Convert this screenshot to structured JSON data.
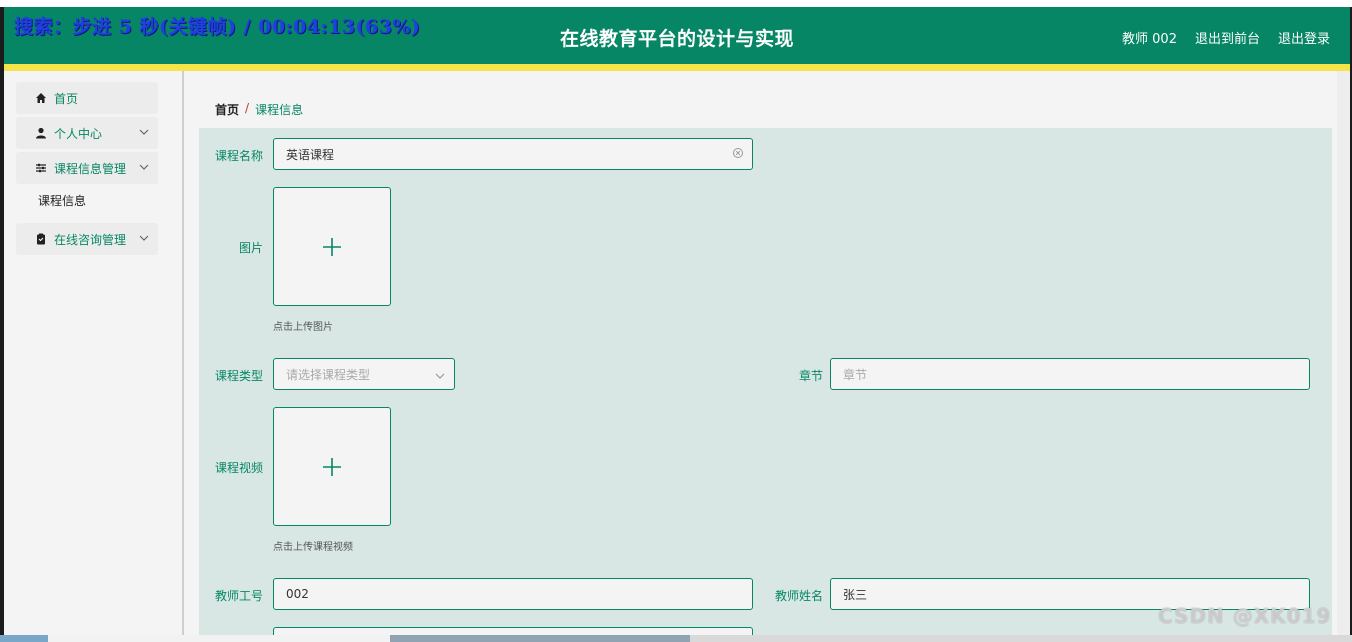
{
  "overlay": {
    "text": "搜索：步进 5 秒(关键帧) / 00:04:13(63%)"
  },
  "header": {
    "title": "在线教育平台的设计与实现",
    "nav": [
      "教师 002",
      "退出到前台",
      "退出登录"
    ]
  },
  "sidebar": {
    "items": [
      {
        "label": "首页",
        "icon": "home-icon"
      },
      {
        "label": "个人中心",
        "icon": "user-icon"
      },
      {
        "label": "课程信息管理",
        "icon": "sliders-icon"
      },
      {
        "label": "在线咨询管理",
        "icon": "clipboard-icon"
      }
    ],
    "sub_item": "课程信息"
  },
  "breadcrumb": {
    "home": "首页",
    "sep": "/",
    "current": "课程信息"
  },
  "form": {
    "course_name": {
      "label": "课程名称",
      "value": "英语课程"
    },
    "picture": {
      "label": "图片",
      "hint": "点击上传图片"
    },
    "course_type": {
      "label": "课程类型",
      "placeholder": "请选择课程类型"
    },
    "chapter": {
      "label": "章节",
      "placeholder": "章节"
    },
    "video": {
      "label": "课程视频",
      "hint": "点击上传课程视频"
    },
    "teacher_id": {
      "label": "教师工号",
      "value": "002"
    },
    "teacher_name": {
      "label": "教师姓名",
      "value": "张三"
    }
  },
  "watermark": "CSDN @XK019",
  "colors": {
    "primary": "#068664",
    "accent": "#f3e44a",
    "form_bg": "#d8e7e4"
  }
}
